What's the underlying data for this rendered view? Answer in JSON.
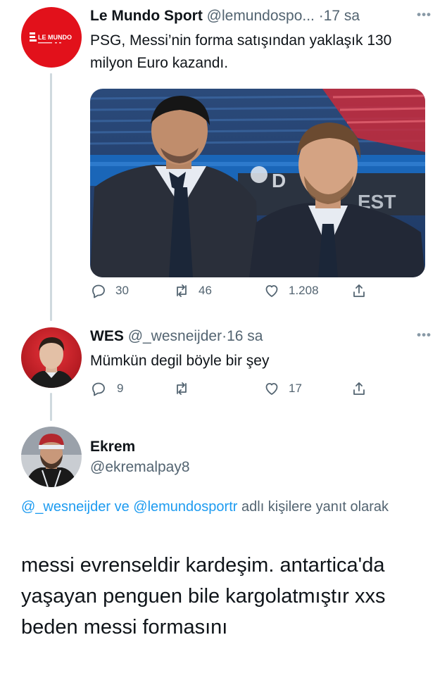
{
  "tweets": [
    {
      "name": "Le Mundo Sport",
      "handle": "@lemundospo...",
      "time": "17 sa",
      "text": "PSG, Messi’nin forma satışından yaklaşık 130 milyon Euro kazandı.",
      "avatar_logo": "LE MUNDO",
      "avatar_color": "#e2111b",
      "replies": "30",
      "retweets": "46",
      "likes": "1.208"
    },
    {
      "name": "WES",
      "handle": "@_wesneijder",
      "time": "16 sa",
      "text": "Mümkün degil böyle bir şey",
      "replies": "9",
      "retweets": "",
      "likes": "17"
    }
  ],
  "main_tweet": {
    "name": "Ekrem",
    "handle": "@ekremalpay8",
    "reply_mention_1": "@_wesneijder",
    "reply_and": "ve",
    "reply_mention_2": "@lemundosportr",
    "reply_suffix": "adlı kişilere yanıt olarak",
    "text": "messi evrenseldir kardeşim. antartica'da yaşayan penguen bile kargolatmıştır xxs beden messi formasını"
  },
  "more_icon": "ellipsis-icon",
  "accent_color": "#1d9bf0"
}
